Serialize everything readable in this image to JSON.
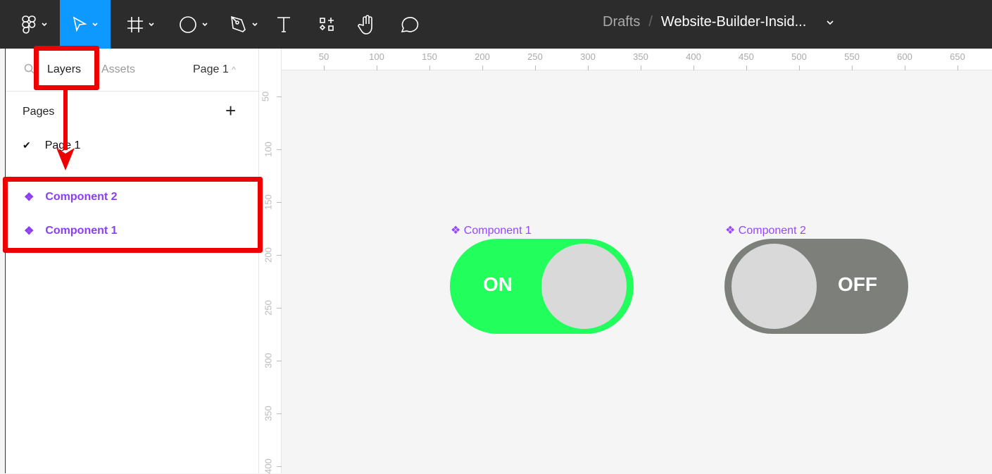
{
  "toolbar": {
    "breadcrumb_drafts": "Drafts",
    "breadcrumb_sep": "/",
    "file_name": "Website-Builder-Insid...",
    "active_color": "#0d99ff"
  },
  "sidebar": {
    "tabs": {
      "layers": "Layers",
      "assets": "Assets",
      "page_selector": "Page 1"
    },
    "pages_heading": "Pages",
    "pages": [
      {
        "label": "Page 1",
        "checked": true
      }
    ],
    "layers": [
      {
        "label": "Component 2"
      },
      {
        "label": "Component 1"
      }
    ]
  },
  "rulers": {
    "x": [
      "50",
      "100",
      "150",
      "200",
      "250",
      "300",
      "350",
      "400",
      "450",
      "500",
      "550",
      "600",
      "650"
    ],
    "y": [
      "50",
      "100",
      "150",
      "200",
      "250",
      "300",
      "350",
      "400"
    ]
  },
  "canvas": {
    "components": [
      {
        "label": "Component 1",
        "state": "ON",
        "color": "#22ff5c"
      },
      {
        "label": "Component 2",
        "state": "OFF",
        "color": "#7d7f7b"
      }
    ]
  }
}
